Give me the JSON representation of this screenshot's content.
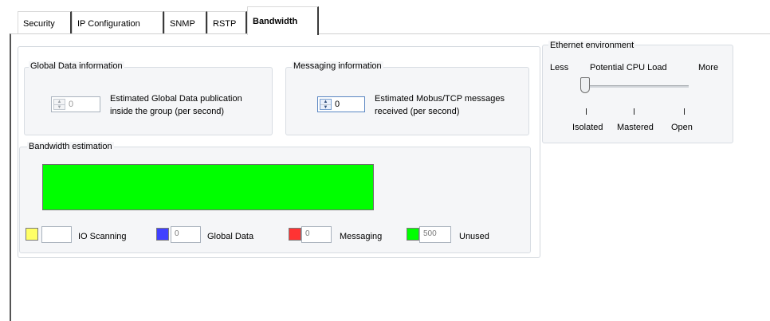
{
  "tabs": [
    {
      "label": "Security"
    },
    {
      "label": "IP Configuration"
    },
    {
      "label": "SNMP"
    },
    {
      "label": "RSTP"
    },
    {
      "label": "Bandwidth",
      "active": true
    }
  ],
  "global_data": {
    "title": "Global Data information",
    "spin_value": "0",
    "description_line1": "Estimated Global Data publication",
    "description_line2": "inside the group (per second)"
  },
  "messaging": {
    "title": "Messaging information",
    "spin_value": "0",
    "description_line1": "Estimated Mobus/TCP messages",
    "description_line2": "received (per second)"
  },
  "ethernet": {
    "title": "Ethernet environment",
    "less_label": "Less",
    "load_label": "Potential CPU Load",
    "more_label": "More",
    "options": [
      "Isolated",
      "Mastered",
      "Open"
    ],
    "selected": "Isolated"
  },
  "bandwidth": {
    "title": "Bandwidth estimation",
    "used_fraction": 0,
    "unused_fraction": 1,
    "legend": [
      {
        "label": "IO Scanning",
        "value": "",
        "color": "#ffff66"
      },
      {
        "label": "Global Data",
        "value": "0",
        "color": "#4040ff"
      },
      {
        "label": "Messaging",
        "value": "0",
        "color": "#ff3333"
      },
      {
        "label": "Unused",
        "value": "500",
        "color": "#00ff00"
      }
    ]
  },
  "colors": {
    "unused_bar": "#00ff00"
  },
  "icons": {
    "spin_up": "up-arrow-icon",
    "spin_down": "down-arrow-icon"
  }
}
